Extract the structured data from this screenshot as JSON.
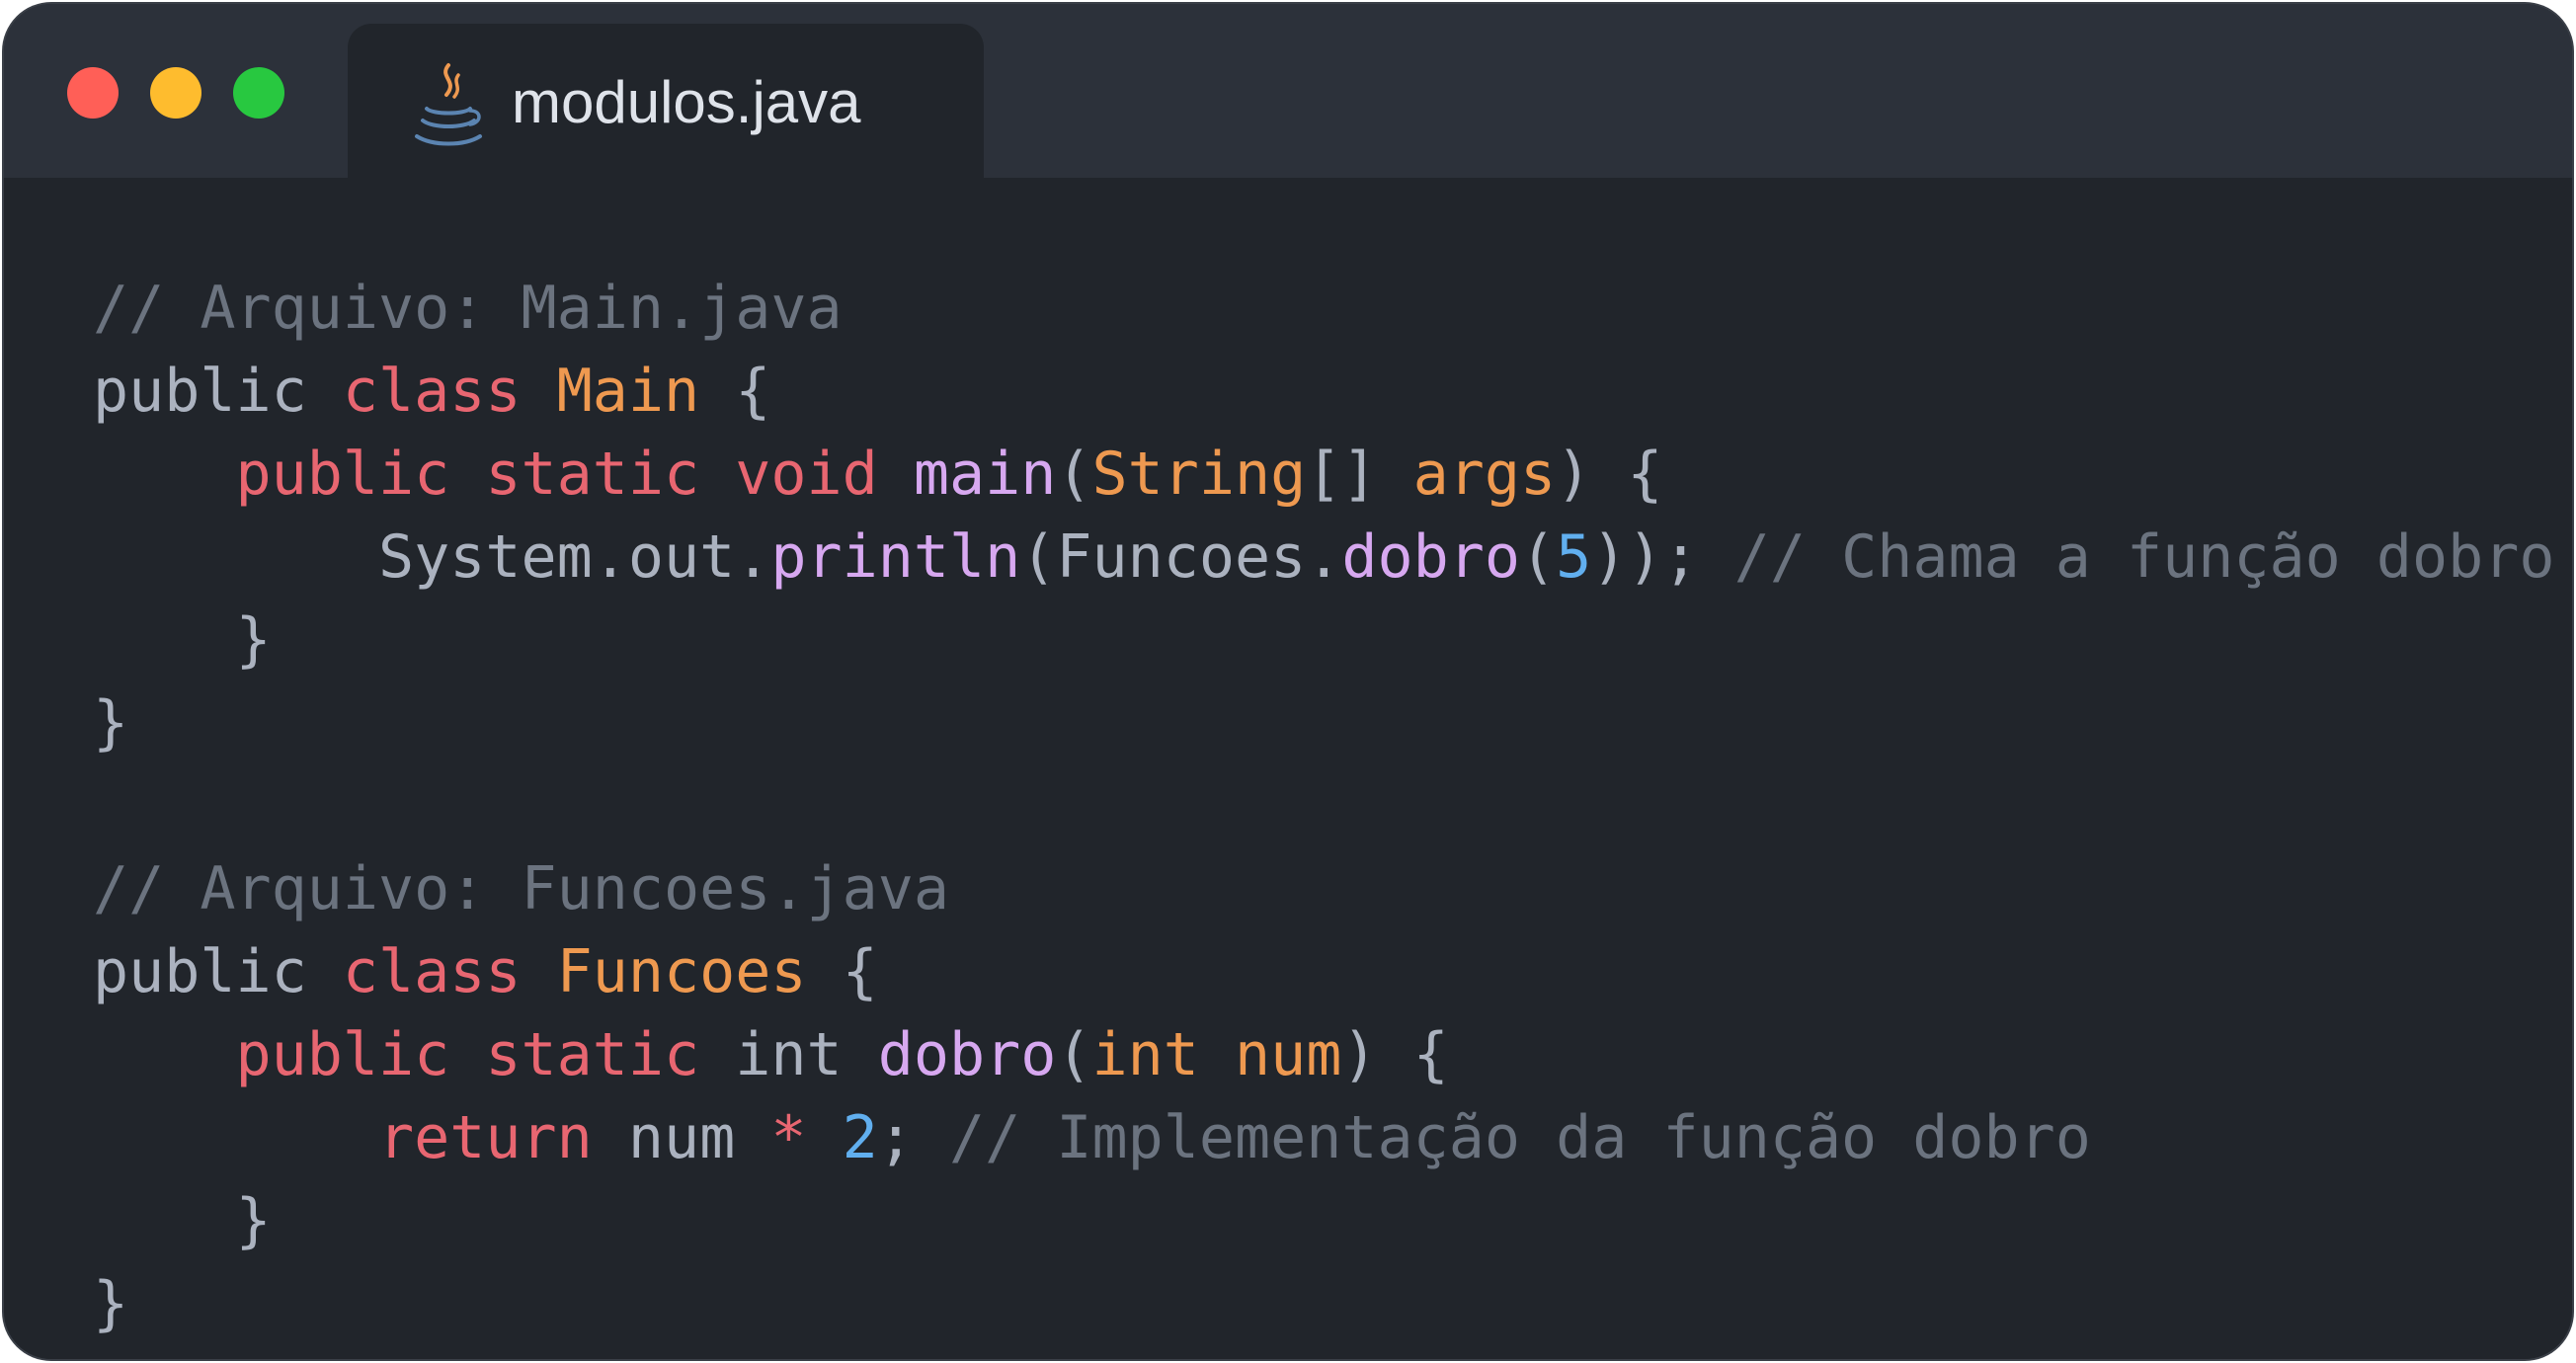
{
  "window": {
    "tab_title": "modulos.java",
    "tab_icon": "java-coffee-cup-icon",
    "traffic_lights": [
      "close",
      "minimize",
      "maximize"
    ],
    "colors": {
      "background": "#21252b",
      "titlebar": "#2c313a",
      "keyword": "#e86671",
      "type": "#ee9950",
      "function": "#d7a8f0",
      "number": "#61afef",
      "comment": "#6b737f",
      "text": "#abb2bf"
    }
  },
  "code": {
    "lines": [
      [
        {
          "t": "// Arquivo: Main.java",
          "c": "cmt"
        }
      ],
      [
        {
          "t": "public ",
          "c": "plain"
        },
        {
          "t": "class ",
          "c": "kw"
        },
        {
          "t": "Main",
          "c": "cls"
        },
        {
          "t": " {",
          "c": "plain"
        }
      ],
      [
        {
          "t": "    ",
          "c": "plain"
        },
        {
          "t": "public ",
          "c": "kw"
        },
        {
          "t": "static ",
          "c": "kw"
        },
        {
          "t": "void ",
          "c": "kw"
        },
        {
          "t": "main",
          "c": "fn"
        },
        {
          "t": "(",
          "c": "plain"
        },
        {
          "t": "String",
          "c": "cls"
        },
        {
          "t": "[] ",
          "c": "plain"
        },
        {
          "t": "args",
          "c": "cls"
        },
        {
          "t": ") {",
          "c": "plain"
        }
      ],
      [
        {
          "t": "        System.out.",
          "c": "plain"
        },
        {
          "t": "println",
          "c": "fn"
        },
        {
          "t": "(Funcoes.",
          "c": "plain"
        },
        {
          "t": "dobro",
          "c": "fn"
        },
        {
          "t": "(",
          "c": "plain"
        },
        {
          "t": "5",
          "c": "num"
        },
        {
          "t": ")); ",
          "c": "plain"
        },
        {
          "t": "// Chama a função dobro",
          "c": "cmt"
        }
      ],
      [
        {
          "t": "    }",
          "c": "plain"
        }
      ],
      [
        {
          "t": "}",
          "c": "plain"
        }
      ],
      [
        {
          "t": "",
          "c": "plain"
        }
      ],
      [
        {
          "t": "// Arquivo: Funcoes.java",
          "c": "cmt"
        }
      ],
      [
        {
          "t": "public ",
          "c": "plain"
        },
        {
          "t": "class ",
          "c": "kw"
        },
        {
          "t": "Funcoes",
          "c": "cls"
        },
        {
          "t": " {",
          "c": "plain"
        }
      ],
      [
        {
          "t": "    ",
          "c": "plain"
        },
        {
          "t": "public ",
          "c": "kw"
        },
        {
          "t": "static ",
          "c": "kw"
        },
        {
          "t": "int ",
          "c": "plain"
        },
        {
          "t": "dobro",
          "c": "fn"
        },
        {
          "t": "(",
          "c": "plain"
        },
        {
          "t": "int ",
          "c": "cls"
        },
        {
          "t": "num",
          "c": "cls"
        },
        {
          "t": ") {",
          "c": "plain"
        }
      ],
      [
        {
          "t": "        ",
          "c": "plain"
        },
        {
          "t": "return ",
          "c": "kw"
        },
        {
          "t": "num ",
          "c": "plain"
        },
        {
          "t": "* ",
          "c": "kw"
        },
        {
          "t": "2",
          "c": "num"
        },
        {
          "t": "; ",
          "c": "plain"
        },
        {
          "t": "// Implementação da função dobro",
          "c": "cmt"
        }
      ],
      [
        {
          "t": "    }",
          "c": "plain"
        }
      ],
      [
        {
          "t": "}",
          "c": "plain"
        }
      ]
    ]
  }
}
